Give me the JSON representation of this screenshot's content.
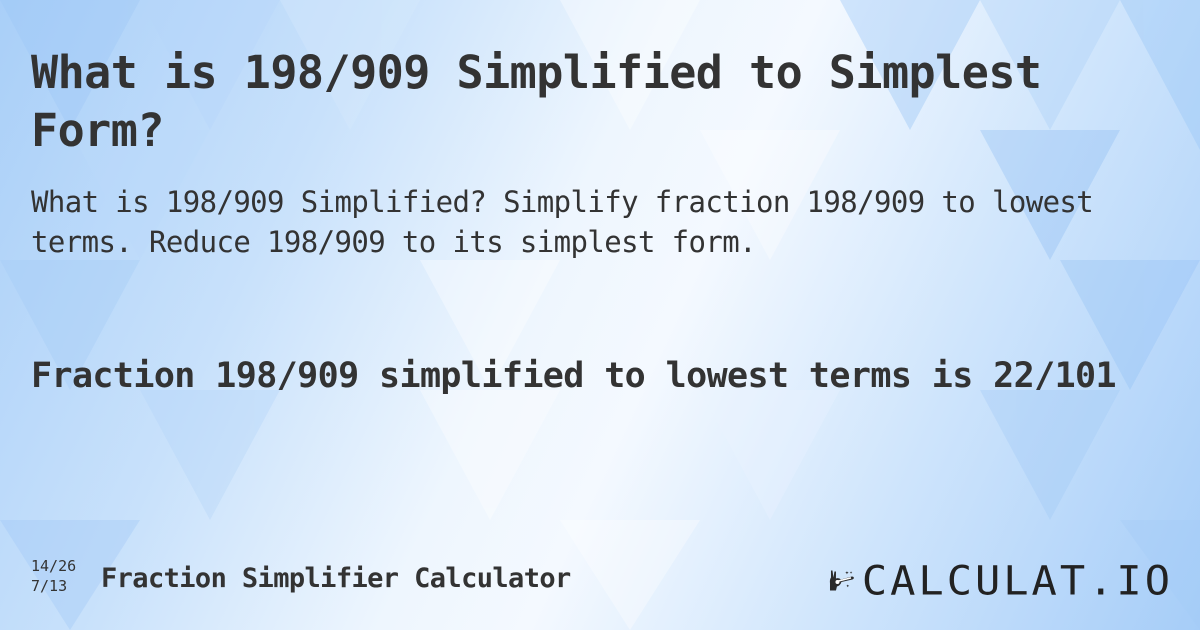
{
  "page": {
    "title": "What is 198/909 Simplified to Simplest Form?",
    "subtitle": "What is 198/909 Simplified? Simplify fraction 198/909 to lowest terms. Reduce 198/909 to its simplest form.",
    "answer": "Fraction 198/909 simplified to lowest terms is 22/101"
  },
  "footer": {
    "fraction_top": "14/26",
    "fraction_bottom": "7/13",
    "calculator_name": "Fraction Simplifier Calculator"
  },
  "logo": {
    "icon": "hand-magic-wand-icon",
    "text": "CALCULAT.IO"
  },
  "colors": {
    "text": "#333333",
    "background_light": "#f4f9ff",
    "background_blue": "#a6cdf8"
  }
}
